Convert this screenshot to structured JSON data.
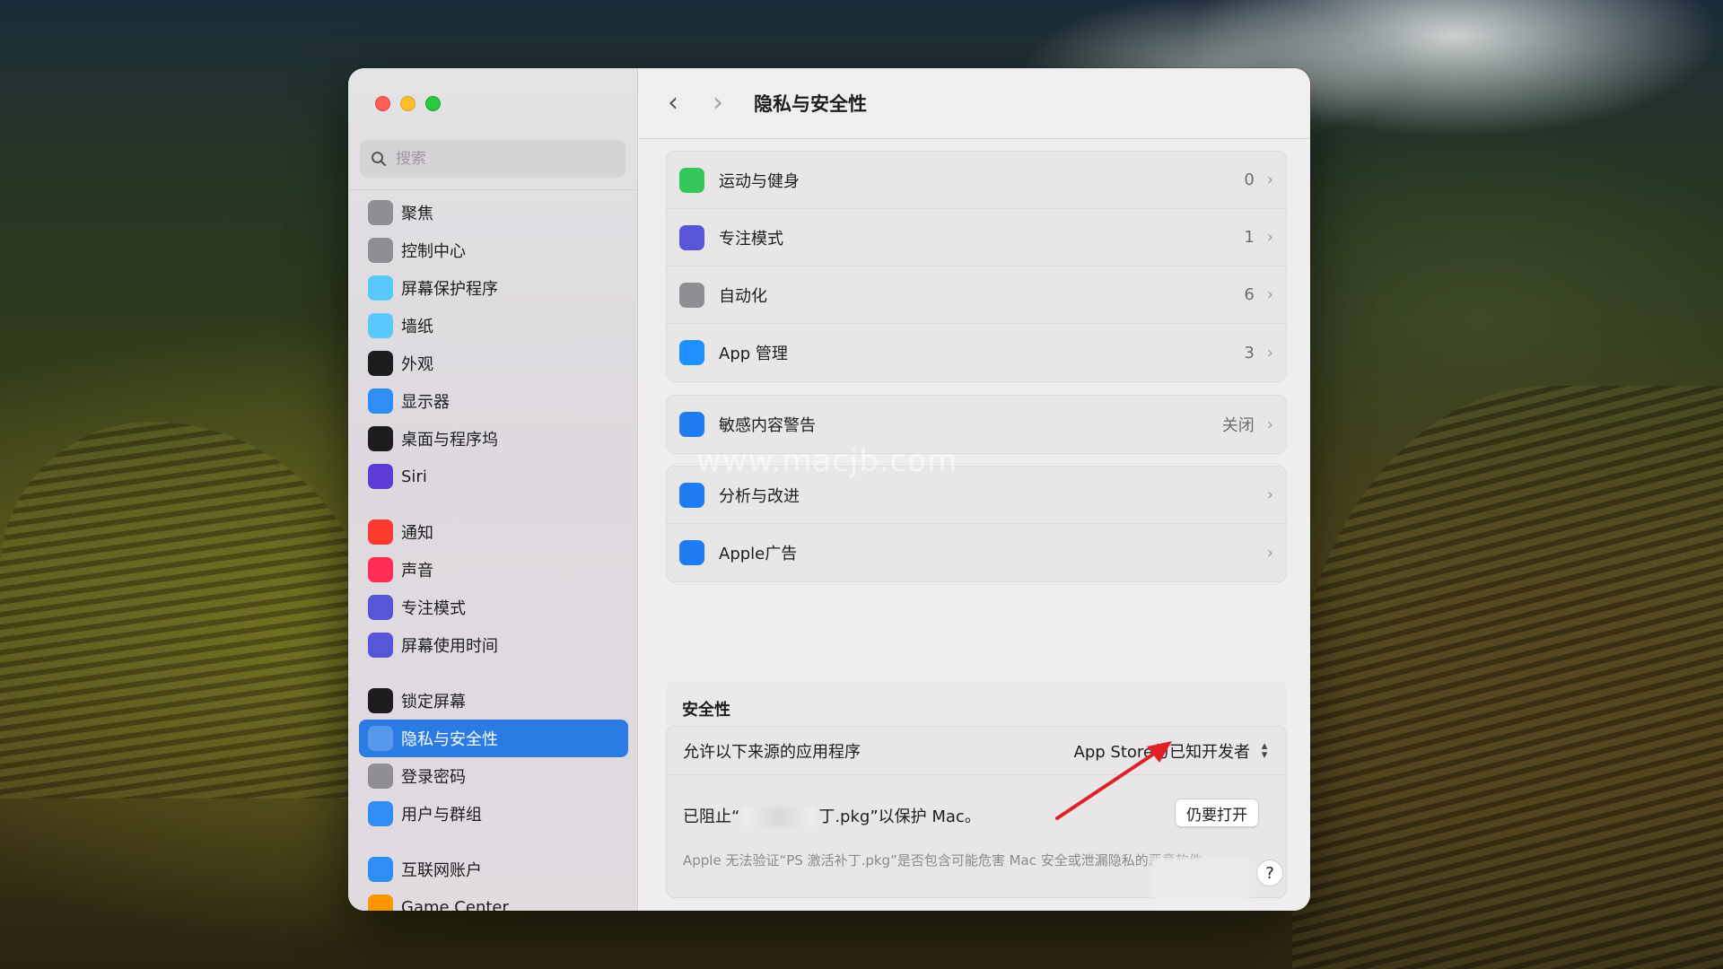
{
  "sidebar": {
    "search_placeholder": "搜索",
    "items": [
      {
        "label": "聚焦",
        "icon": "magnifier-icon",
        "color": "#8e8e93"
      },
      {
        "label": "控制中心",
        "icon": "switches-icon",
        "color": "#8e8e93"
      },
      {
        "label": "屏幕保护程序",
        "icon": "screensaver-icon",
        "color": "#5ac8fa"
      },
      {
        "label": "墙纸",
        "icon": "flower-icon",
        "color": "#5ac8fa"
      },
      {
        "label": "外观",
        "icon": "appearance-icon",
        "color": "#1d1d1f"
      },
      {
        "label": "显示器",
        "icon": "sun-icon",
        "color": "#2f8ef5"
      },
      {
        "label": "桌面与程序坞",
        "icon": "dock-icon",
        "color": "#1d1d1f"
      },
      {
        "label": "Siri",
        "icon": "siri-icon",
        "color": "#5e3bd8"
      },
      {
        "label": "通知",
        "icon": "bell-icon",
        "color": "#ff3b30"
      },
      {
        "label": "声音",
        "icon": "speaker-icon",
        "color": "#ff2d55"
      },
      {
        "label": "专注模式",
        "icon": "moon-icon",
        "color": "#5856d6"
      },
      {
        "label": "屏幕使用时间",
        "icon": "hourglass-icon",
        "color": "#5856d6"
      },
      {
        "label": "锁定屏幕",
        "icon": "lock-icon",
        "color": "#1d1d1f"
      },
      {
        "label": "隐私与安全性",
        "icon": "hand-icon",
        "color": "#2f7de1",
        "selected": true
      },
      {
        "label": "登录密码",
        "icon": "padlock-icon",
        "color": "#8e8e93"
      },
      {
        "label": "用户与群组",
        "icon": "users-icon",
        "color": "#2f8ef5"
      },
      {
        "label": "互联网账户",
        "icon": "at-icon",
        "color": "#2f8ef5"
      },
      {
        "label": "Game Center",
        "icon": "gamecenter-icon",
        "color": "#ff9500"
      }
    ]
  },
  "header": {
    "back": "‹",
    "forward": "›",
    "title": "隐私与安全性"
  },
  "privacy_rows": [
    {
      "label": "运动与健身",
      "value": "0",
      "icon": "fitness-icon",
      "color": "#34c759"
    },
    {
      "label": "专注模式",
      "value": "1",
      "icon": "moon-icon",
      "color": "#5856d6"
    },
    {
      "label": "自动化",
      "value": "6",
      "icon": "gears-icon",
      "color": "#8e8e93"
    },
    {
      "label": "App 管理",
      "value": "3",
      "icon": "appstore-icon",
      "color": "#1e90ff"
    }
  ],
  "sensitive_row": {
    "label": "敏感内容警告",
    "value": "关闭",
    "icon": "eye-icon",
    "color": "#1e7cf0"
  },
  "analytics_rows": [
    {
      "label": "分析与改进",
      "value": "",
      "icon": "bar-chart-icon",
      "color": "#1e7cf0"
    },
    {
      "label": "Apple广告",
      "value": "",
      "icon": "megaphone-icon",
      "color": "#1e7cf0"
    }
  ],
  "security": {
    "title": "安全性",
    "allow_label": "允许以下来源的应用程序",
    "allow_value": "App Store与已知开发者",
    "blocked_prefix": "已阻止“",
    "blocked_suffix": "丁.pkg”以保护 Mac。",
    "open_button": "仍要打开",
    "note": "Apple 无法验证“PS 激活补丁.pkg”是否包含可能危害 Mac 安全或泄漏隐私的恶意软件。"
  },
  "help_label": "?",
  "watermark": "www.macjb.com",
  "chevron": "›"
}
